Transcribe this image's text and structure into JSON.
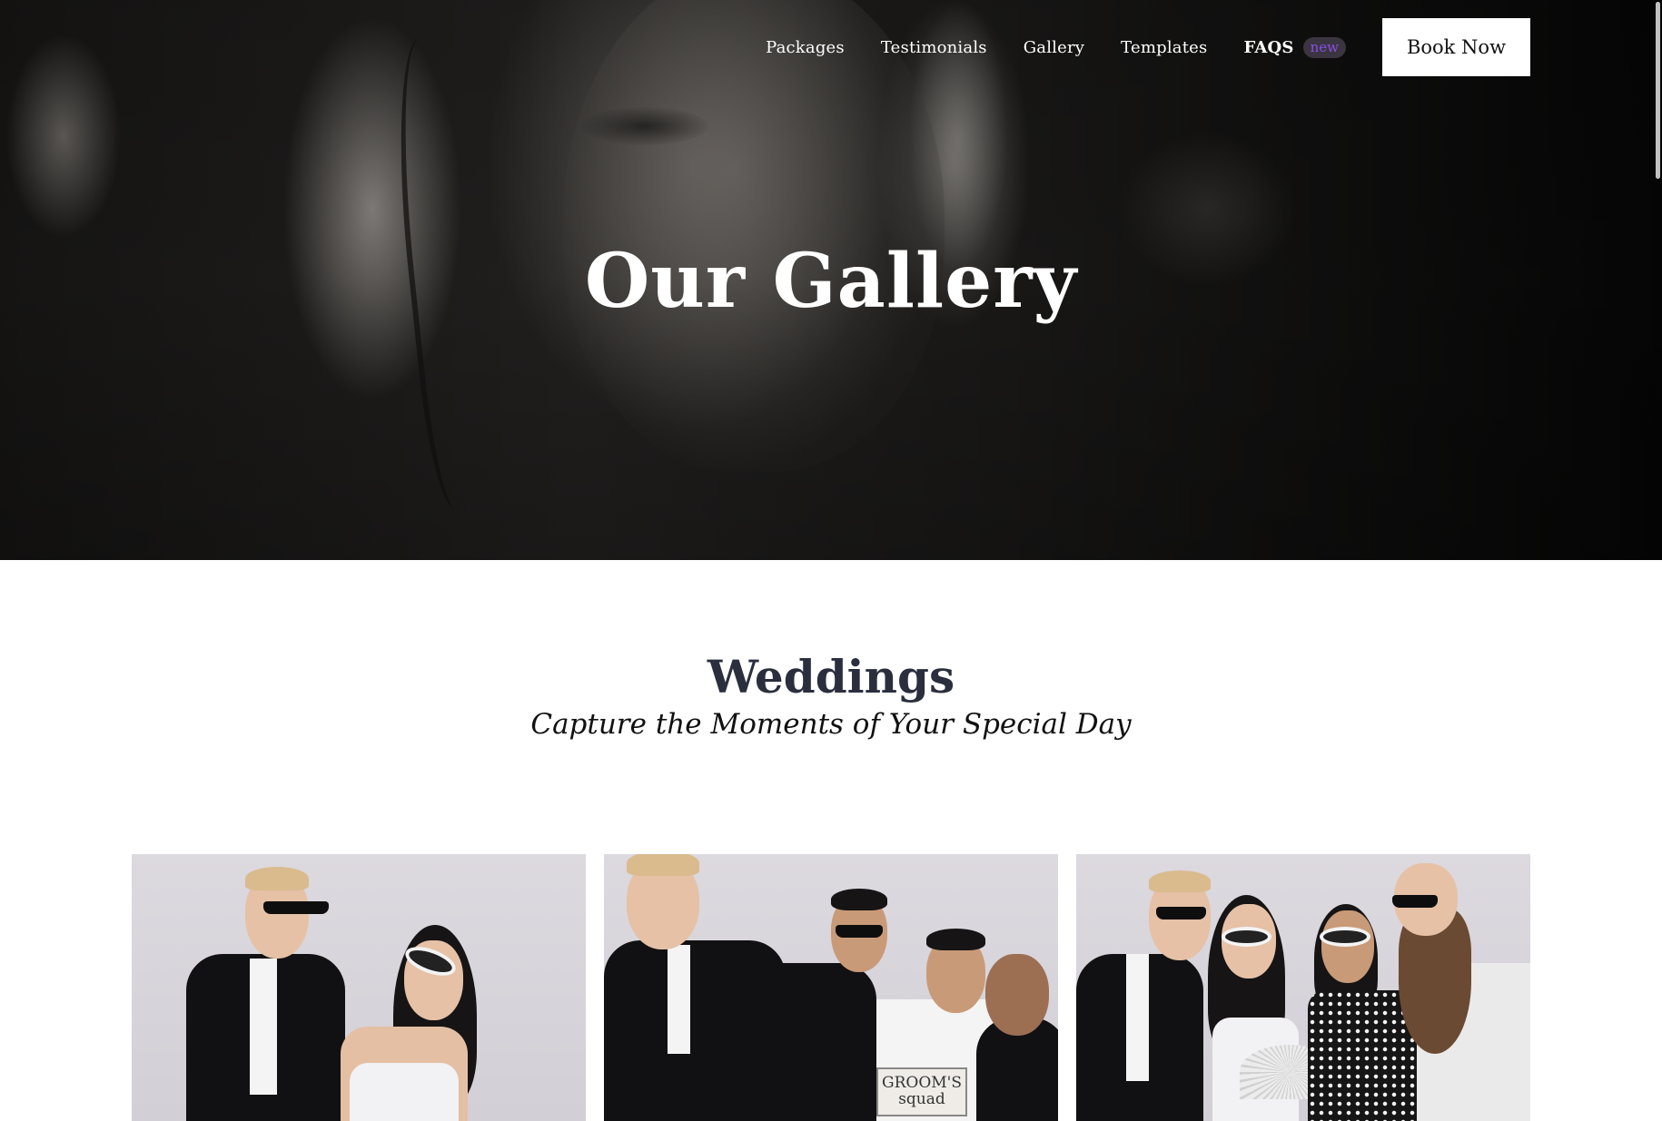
{
  "nav": {
    "items": [
      {
        "label": "Packages"
      },
      {
        "label": "Testimonials"
      },
      {
        "label": "Gallery"
      },
      {
        "label": "Templates"
      }
    ],
    "faq": {
      "label": "FAQS",
      "badge": "new"
    },
    "cta_label": "Book Now"
  },
  "hero": {
    "title": "Our Gallery"
  },
  "section": {
    "title": "Weddings",
    "subtitle": "Capture the Moments of Your Special Day"
  },
  "gallery": {
    "photos": [
      {
        "name": "couple-photo"
      },
      {
        "name": "grooms-squad-photo",
        "sign_line1": "GROOM'S",
        "sign_line2": "squad"
      },
      {
        "name": "group-photo"
      }
    ]
  },
  "colors": {
    "accent_badge_text": "#8a4fe8",
    "section_title": "#2a2e3d",
    "cta_background": "#ffffff"
  }
}
